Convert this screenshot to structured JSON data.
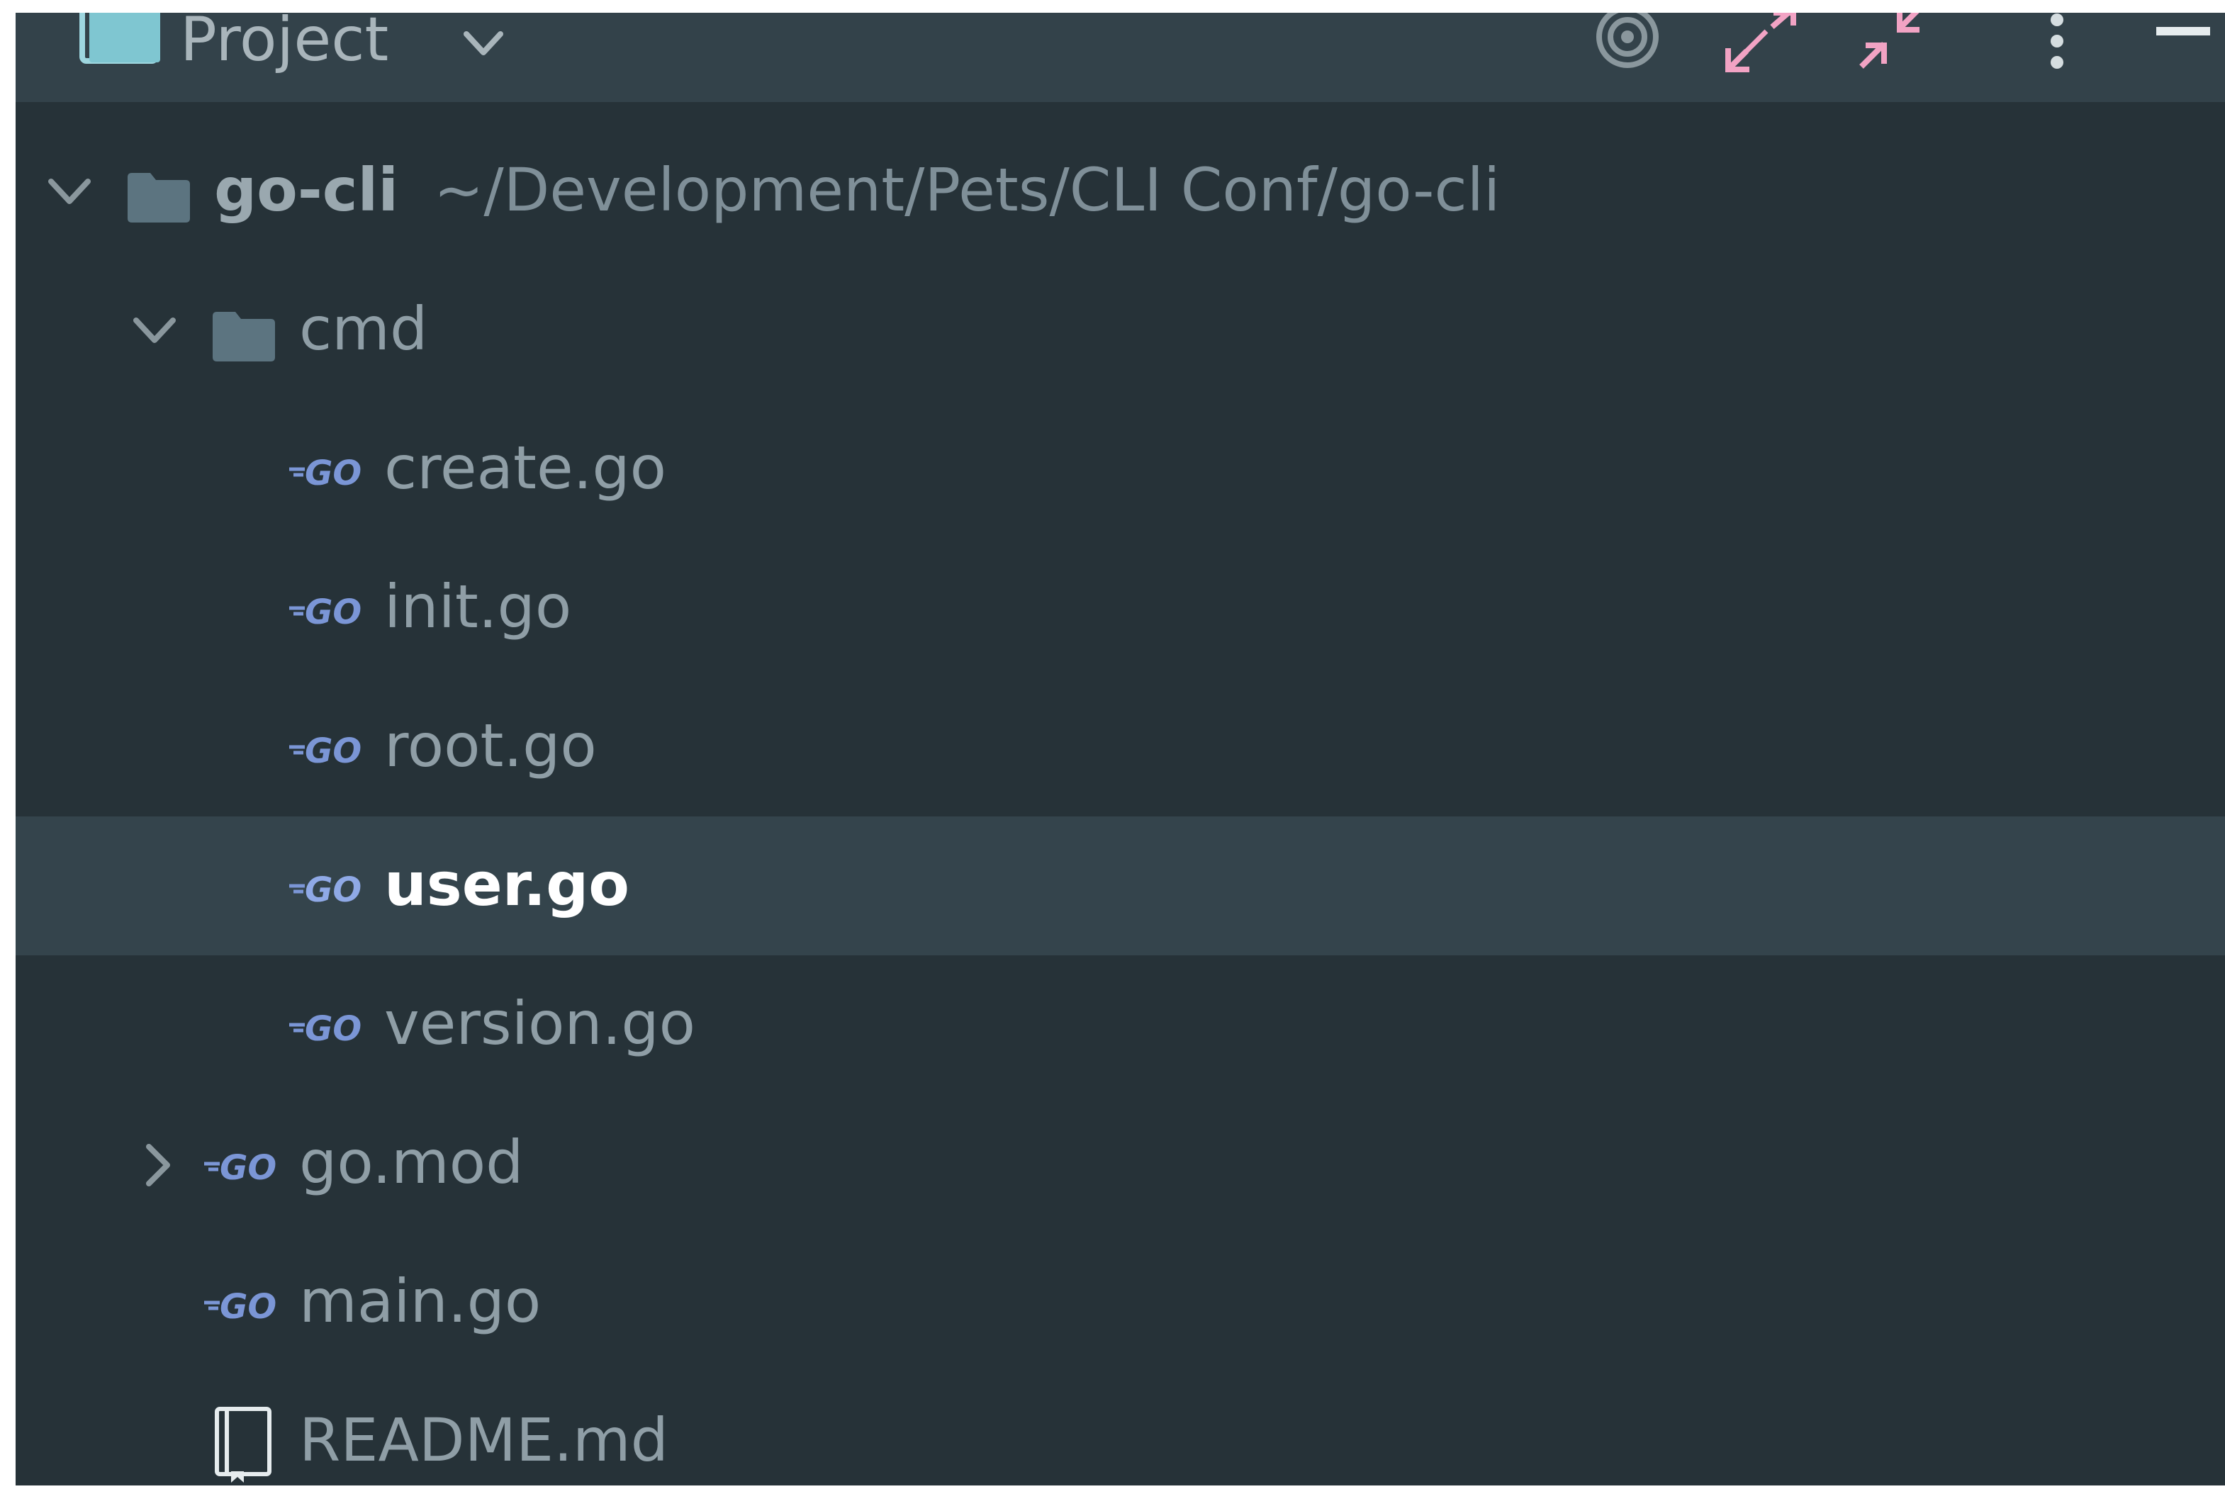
{
  "header": {
    "title": "Project",
    "icons": [
      "project-view-icon",
      "chevron-down-icon",
      "target-icon",
      "expand-all-icon",
      "collapse-all-icon",
      "more-vertical-icon",
      "minimize-icon"
    ]
  },
  "tree": {
    "root": {
      "name": "go-cli",
      "path": "~/Development/Pets/CLI Conf/go-cli"
    },
    "cmd": {
      "name": "cmd"
    },
    "files": {
      "create": "create.go",
      "init": "init.go",
      "root": "root.go",
      "user": "user.go",
      "version": "version.go",
      "gomod": "go.mod",
      "main": "main.go",
      "readme": "README.md"
    },
    "selected": "user.go"
  },
  "colors": {
    "panel_bg": "#263238",
    "header_bg": "#33424a",
    "selection_bg": "#34444c",
    "text": "#8f9ea6",
    "selected_text": "#ffffff",
    "go_icon": "#7b96d6",
    "folder": "#5c7480",
    "accent_pink": "#f2a3c4"
  }
}
